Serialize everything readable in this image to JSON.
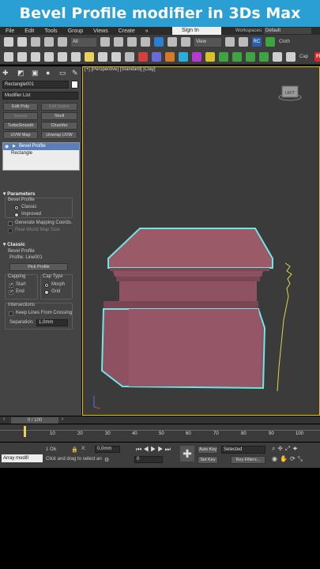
{
  "banner": {
    "title": "Bevel Profile modifier in 3Ds Max"
  },
  "menu": {
    "items": [
      "File",
      "Edit",
      "Tools",
      "Group",
      "Views",
      "Create"
    ],
    "more": "»",
    "signin": "Sign In",
    "workspaces_label": "Workspaces:",
    "workspaces_value": "Default"
  },
  "toolbar": {
    "filter": "All",
    "view": "View",
    "right_label": "Cloth",
    "capture": "Cap",
    "fp": "FP",
    "rc": "RC"
  },
  "command_panel": {
    "object_name": "Rectangle001",
    "modifier_list": "Modifier List",
    "buttons": [
      "Edit Poly",
      "Edit Spline",
      "Sweep",
      "Shell",
      "TurboSmooth",
      "Chamfer",
      "UVW Map",
      "Unwrap UVW"
    ],
    "stack": [
      "Bevel Profile",
      "Rectangle"
    ]
  },
  "parameters": {
    "rollout_title": "Parameters",
    "bevel_profile_label": "Bevel Profile",
    "options": [
      "Classic",
      "Improved"
    ],
    "gen_mapping": "Generate Mapping Coords.",
    "real_world": "Real-World Map Size"
  },
  "classic": {
    "rollout_title": "Classic",
    "bevel_profile_label": "Bevel Profile",
    "profile_label": "Profile: Line001",
    "pick_profile": "Pick Profile",
    "capping_label": "Capping",
    "start": "Start",
    "end": "End",
    "cap_type_label": "Cap Type",
    "morph": "Morph",
    "grid": "Grid",
    "intersections_label": "Intersections",
    "keep_lines": "Keep Lines From Crossing",
    "separation_label": "Separation:",
    "separation_value": "1,0mm"
  },
  "viewport": {
    "label": "[+] [Perspective] [Standard] [Clay]",
    "cube_label": "LEFT"
  },
  "timeline": {
    "frame": "0 / 100",
    "ticks": [
      "10",
      "20",
      "30",
      "40",
      "50",
      "60",
      "70",
      "80",
      "90",
      "100"
    ]
  },
  "status": {
    "maxscript": "Array modifi",
    "prompt": "Click and drag to select an",
    "selected_count": "1 Ob",
    "x_value": "0,0mm",
    "frame_value": "0",
    "auto_key": "Auto Key",
    "set_key": "Set Key",
    "selected": "Selected",
    "key_filters": "Key Filters..."
  },
  "colors": {
    "banner": "#2a9fd3",
    "box": "#9a5a68",
    "highlight": "#6fe6e6",
    "profile": "#d8d84a"
  }
}
